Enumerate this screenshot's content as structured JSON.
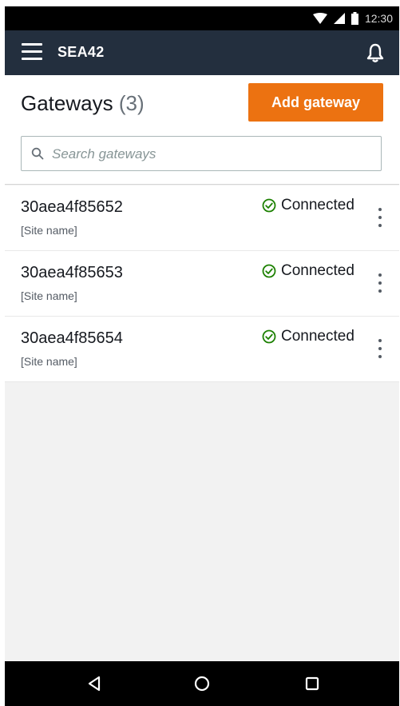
{
  "status_bar": {
    "time": "12:30"
  },
  "app_bar": {
    "title": "SEA42"
  },
  "header": {
    "title": "Gateways",
    "count": "(3)",
    "add_button": "Add gateway"
  },
  "search": {
    "placeholder": "Search gateways",
    "value": ""
  },
  "gateways": [
    {
      "id": "30aea4f85652",
      "site": "[Site name]",
      "status": "Connected"
    },
    {
      "id": "30aea4f85653",
      "site": "[Site name]",
      "status": "Connected"
    },
    {
      "id": "30aea4f85654",
      "site": "[Site name]",
      "status": "Connected"
    }
  ],
  "colors": {
    "app_bar": "#232f3e",
    "accent": "#ec7211",
    "connected": "#1d8102"
  },
  "icons": {
    "status_bar": [
      "wifi-icon",
      "signal-icon",
      "battery-icon"
    ],
    "app_bar": [
      "hamburger-menu-icon",
      "bell-icon"
    ],
    "search": "search-icon",
    "row_status": "check-circle-icon",
    "row_menu": "more-vertical-icon",
    "nav": [
      "back-icon",
      "home-icon",
      "recents-icon"
    ]
  }
}
